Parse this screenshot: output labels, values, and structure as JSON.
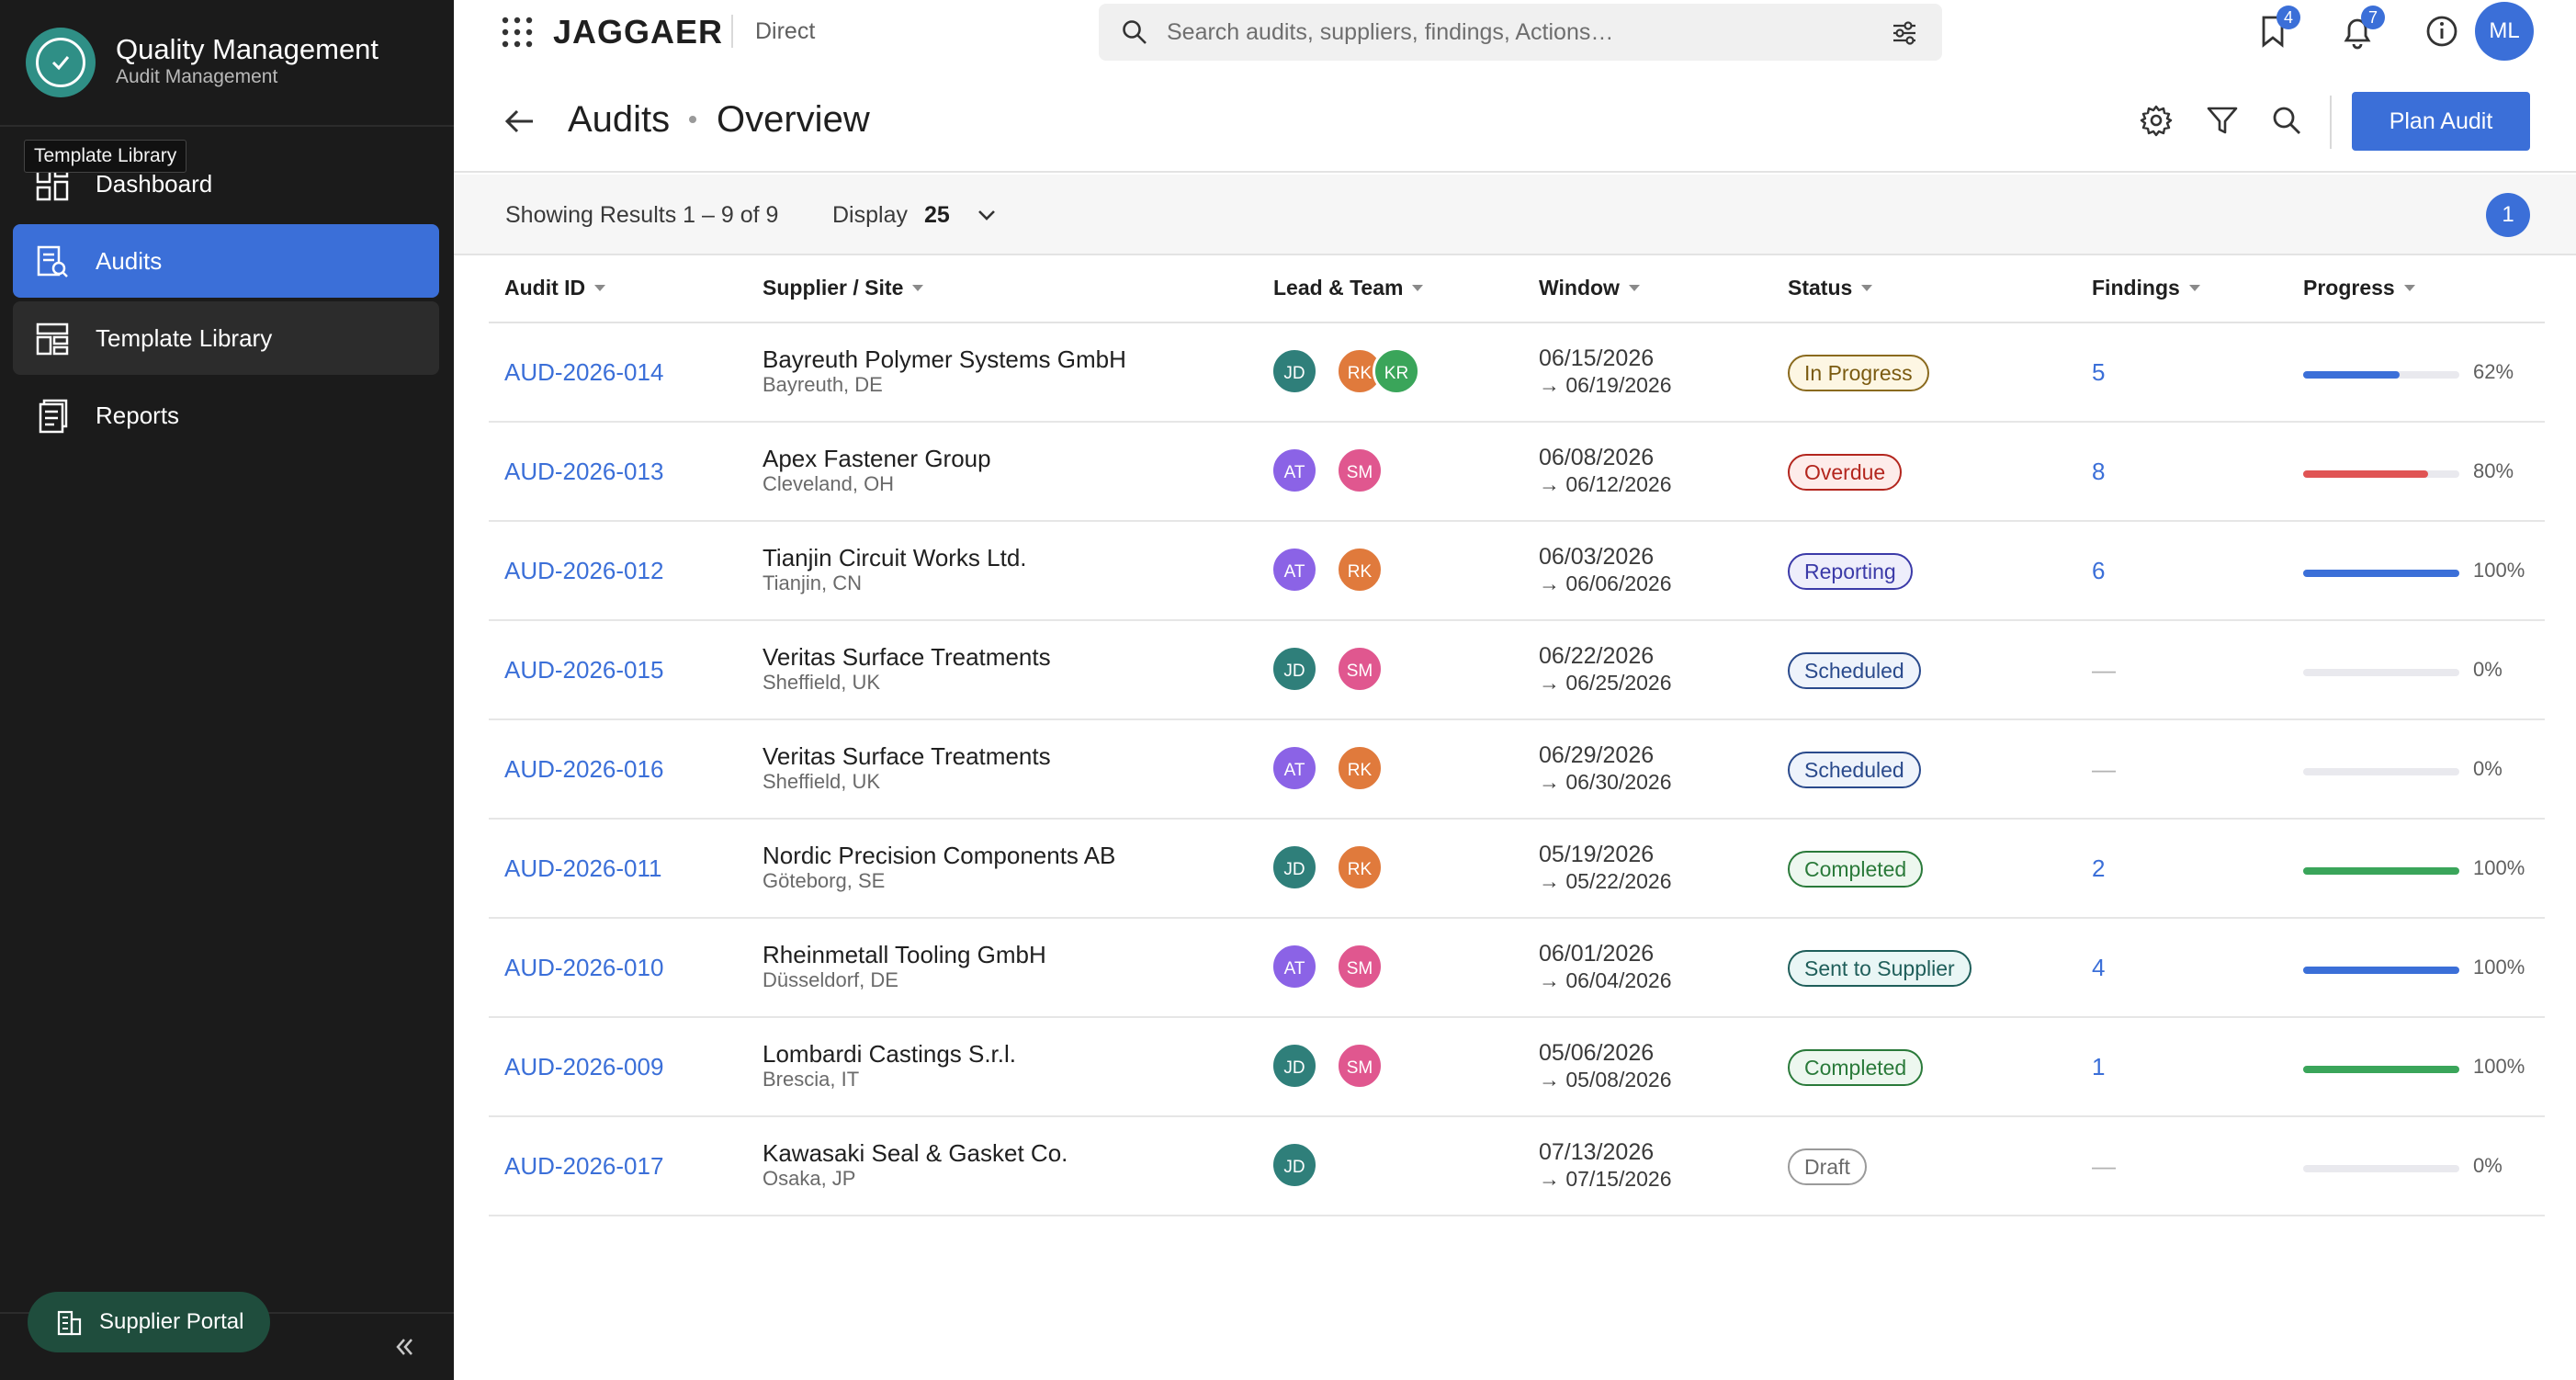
{
  "sidebar": {
    "app_title": "Quality Management",
    "app_subtitle": "Audit Management",
    "tooltip": "Template Library",
    "items": [
      {
        "label": "Dashboard",
        "icon": "dashboard-icon"
      },
      {
        "label": "Audits",
        "icon": "audits-icon",
        "active": true
      },
      {
        "label": "Template Library",
        "icon": "template-icon",
        "hovered": true
      },
      {
        "label": "Reports",
        "icon": "reports-icon"
      }
    ],
    "portal_button": "Supplier Portal"
  },
  "topbar": {
    "brand": "JAGGAER",
    "brand_sub": "Direct",
    "search_placeholder": "Search audits, suppliers, findings, Actions…",
    "bookmarks_badge": "4",
    "notifications_badge": "7",
    "user_initials": "ML"
  },
  "header": {
    "crumb_parent": "Audits",
    "crumb_current": "Overview",
    "plan_button": "Plan Audit"
  },
  "results": {
    "showing": "Showing Results 1 – 9 of 9",
    "display_label": "Display",
    "display_value": "25",
    "page": "1"
  },
  "table": {
    "columns": [
      "Audit ID",
      "Supplier / Site",
      "Lead & Team",
      "Window",
      "Status",
      "Findings",
      "Progress"
    ],
    "rows": [
      {
        "id": "AUD-2026-014",
        "supplier": "Bayreuth Polymer Systems GmbH",
        "site": "Bayreuth, DE",
        "team": [
          "JD",
          "RK",
          "KR"
        ],
        "from": "06/15/2026",
        "to": "→ 06/19/2026",
        "status": "In Progress",
        "findings": "5",
        "progress": 0.62,
        "progress_label": "62%"
      },
      {
        "id": "AUD-2026-013",
        "supplier": "Apex Fastener Group",
        "site": "Cleveland, OH",
        "team": [
          "AT",
          "SM"
        ],
        "from": "06/08/2026",
        "to": "→ 06/12/2026",
        "status": "Overdue",
        "findings": "8",
        "progress": 0.8,
        "progress_label": "80%"
      },
      {
        "id": "AUD-2026-012",
        "supplier": "Tianjin Circuit Works Ltd.",
        "site": "Tianjin, CN",
        "team": [
          "AT",
          "RK"
        ],
        "from": "06/03/2026",
        "to": "→ 06/06/2026",
        "status": "Reporting",
        "findings": "6",
        "progress": 1.0,
        "progress_label": "100%"
      },
      {
        "id": "AUD-2026-015",
        "supplier": "Veritas Surface Treatments",
        "site": "Sheffield, UK",
        "team": [
          "JD",
          "SM"
        ],
        "from": "06/22/2026",
        "to": "→ 06/25/2026",
        "status": "Scheduled",
        "findings": "—",
        "progress": 0,
        "progress_label": "0%"
      },
      {
        "id": "AUD-2026-016",
        "supplier": "Veritas Surface Treatments",
        "site": "Sheffield, UK",
        "team": [
          "AT",
          "RK"
        ],
        "from": "06/29/2026",
        "to": "→ 06/30/2026",
        "status": "Scheduled",
        "findings": "—",
        "progress": 0,
        "progress_label": "0%"
      },
      {
        "id": "AUD-2026-011",
        "supplier": "Nordic Precision Components AB",
        "site": "Göteborg, SE",
        "team": [
          "JD",
          "RK"
        ],
        "from": "05/19/2026",
        "to": "→ 05/22/2026",
        "status": "Completed",
        "findings": "2",
        "progress": 1.0,
        "progress_label": "100%"
      },
      {
        "id": "AUD-2026-010",
        "supplier": "Rheinmetall Tooling GmbH",
        "site": "Düsseldorf, DE",
        "team": [
          "AT",
          "SM"
        ],
        "from": "06/01/2026",
        "to": "→ 06/04/2026",
        "status": "Sent to Supplier",
        "findings": "4",
        "progress": 1.0,
        "progress_label": "100%"
      },
      {
        "id": "AUD-2026-009",
        "supplier": "Lombardi Castings S.r.l.",
        "site": "Brescia, IT",
        "team": [
          "JD",
          "SM"
        ],
        "from": "05/06/2026",
        "to": "→ 05/08/2026",
        "status": "Completed",
        "findings": "1",
        "progress": 1.0,
        "progress_label": "100%"
      },
      {
        "id": "AUD-2026-017",
        "supplier": "Kawasaki Seal & Gasket Co.",
        "site": "Osaka, JP",
        "team": [
          "JD"
        ],
        "from": "07/13/2026",
        "to": "→ 07/15/2026",
        "status": "Draft",
        "findings": "—",
        "progress": 0,
        "progress_label": "0%"
      }
    ]
  },
  "colors": {
    "accent": "#3b6fd8",
    "avatar": {
      "JD": "#2f7f7a",
      "RK": "#e07a3c",
      "KR": "#3aa55a",
      "AT": "#8b63e6",
      "SM": "#e0578f"
    },
    "status": {
      "In Progress": {
        "fg": "#7a5a10",
        "bg": "#fdf6e3",
        "border": "#8a6a1e"
      },
      "Overdue": {
        "fg": "#b3261e",
        "bg": "#fdecea",
        "border": "#b3261e"
      },
      "Reporting": {
        "fg": "#3b3aa8",
        "bg": "#eeeefb",
        "border": "#3b3aa8"
      },
      "Scheduled": {
        "fg": "#2a4a8c",
        "bg": "#eef3fb",
        "border": "#2a4a8c"
      },
      "Completed": {
        "fg": "#2a7a3a",
        "bg": "#edf7ef",
        "border": "#2a7a3a"
      },
      "Sent to Supplier": {
        "fg": "#1f5e5a",
        "bg": "#e9f6f5",
        "border": "#1f5e5a"
      },
      "Draft": {
        "fg": "#6a6a6a",
        "bg": "#ffffff",
        "border": "#9a9a9a"
      }
    },
    "progress": {
      "In Progress": "#3b6fd8",
      "Overdue": "#e05454",
      "Reporting": "#3b6fd8",
      "Completed": "#3aa55a",
      "Sent to Supplier": "#3b6fd8",
      "Scheduled": "#3b6fd8",
      "Draft": "#3b6fd8"
    }
  }
}
